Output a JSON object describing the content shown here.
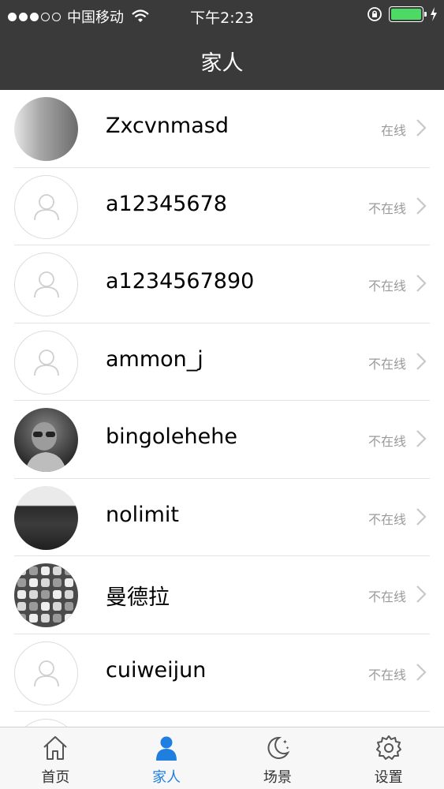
{
  "status_bar": {
    "carrier": "中国移动",
    "time": "下午2:23",
    "signal_strength": 3,
    "battery_level": 1.0,
    "icons": [
      "signal-icon",
      "wifi-icon",
      "rotation-lock-icon",
      "battery-icon",
      "charging-icon"
    ]
  },
  "nav": {
    "title": "家人"
  },
  "contacts": [
    {
      "name": "Zxcvnmasd",
      "status": "在线",
      "avatar": "gradient-photo"
    },
    {
      "name": "a12345678",
      "status": "不在线",
      "avatar": "default-user"
    },
    {
      "name": "a1234567890",
      "status": "不在线",
      "avatar": "default-user"
    },
    {
      "name": "ammon_j",
      "status": "不在线",
      "avatar": "default-user"
    },
    {
      "name": "bingolehehe",
      "status": "不在线",
      "avatar": "child-photo"
    },
    {
      "name": "nolimit",
      "status": "不在线",
      "avatar": "dark-photo"
    },
    {
      "name": "曼德拉",
      "status": "不在线",
      "avatar": "app-grid-photo"
    },
    {
      "name": "cuiweijun",
      "status": "不在线",
      "avatar": "default-user"
    }
  ],
  "tabs": [
    {
      "label": "首页",
      "icon": "home-icon",
      "active": false
    },
    {
      "label": "家人",
      "icon": "person-icon",
      "active": true
    },
    {
      "label": "场景",
      "icon": "moon-stars-icon",
      "active": false
    },
    {
      "label": "设置",
      "icon": "gear-icon",
      "active": false
    }
  ],
  "colors": {
    "bar_background": "#3a3a3a",
    "tab_active": "#1e7fe0",
    "status_text": "#9a9a9a",
    "battery": "#4cd964"
  }
}
